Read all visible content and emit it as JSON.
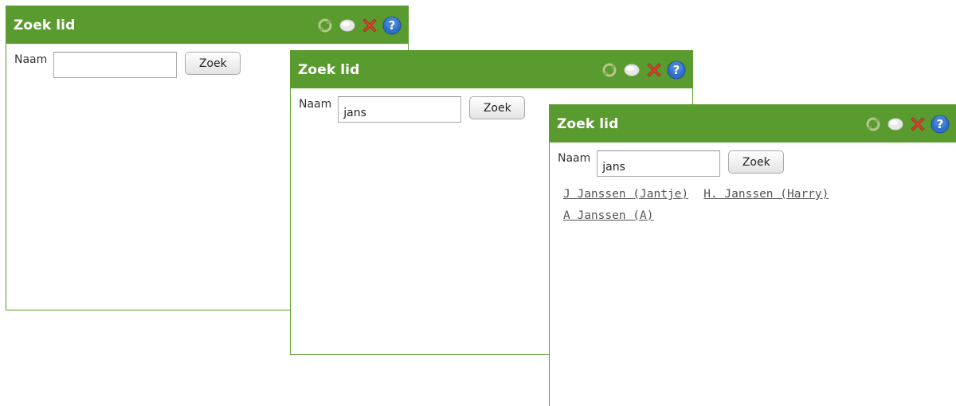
{
  "title": "Zoek lid",
  "label": "Naam",
  "button": "Zoek",
  "windows": [
    {
      "input_value": "",
      "results": []
    },
    {
      "input_value": "jans",
      "results": []
    },
    {
      "input_value": "jans",
      "results": [
        "J Janssen (Jantje)",
        "H. Janssen (Harry)",
        "A Janssen (A)"
      ]
    }
  ],
  "icons": [
    "refresh-icon",
    "minimize-icon",
    "close-icon",
    "help-icon"
  ],
  "colors": {
    "titlebar": "#5a9b30",
    "border": "#5c9b2e",
    "link": "#555555"
  }
}
